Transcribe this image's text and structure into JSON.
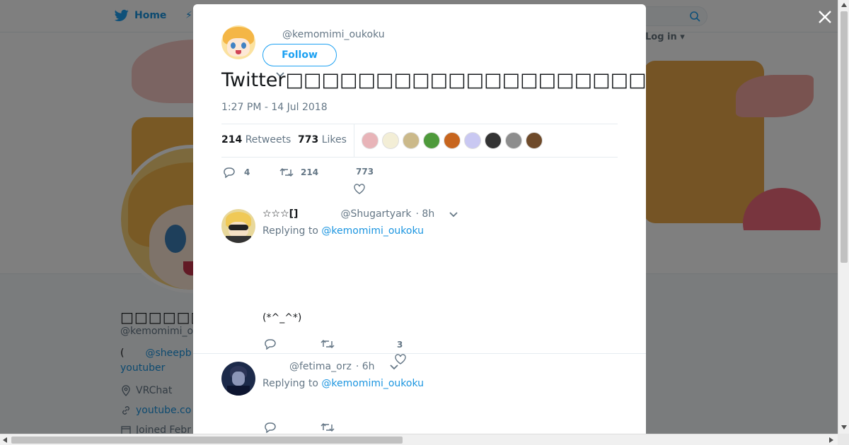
{
  "nav": {
    "home_label": "Home",
    "login_label": "Log in"
  },
  "profile": {
    "name": "□□□□□□□□□□□",
    "handle": "@kemomimi_o",
    "bio_prefix": "(",
    "bio_link": "@sheepb",
    "bio_line2": "youtuber",
    "location": "VRChat",
    "url": "youtube.co",
    "joined": "Joined Febr"
  },
  "tweet": {
    "handle": "@kemomimi_oukoku",
    "follow_label": "Follow",
    "text": "Twitter□□□□□□□□□□□□□□□□□□□□□□□□□□□□□□□□□□□□□□□□□□□□□□",
    "timestamp": "1:27 PM - 14 Jul 2018",
    "retweets_count": "214",
    "retweets_label": "Retweets",
    "likes_count": "773",
    "likes_label": "Likes",
    "reply_count": "4",
    "retweet_count": "214",
    "like_count": "773",
    "liker_colors": [
      "#e8b4b8",
      "#f3eed6",
      "#cbb98a",
      "#4e9a3b",
      "#c7651e",
      "#c9c8f2",
      "#333333",
      "#8d8d8d",
      "#6e4a2a"
    ]
  },
  "replies": [
    {
      "name": "☆☆☆[]",
      "handle": "@Shugartyark",
      "time": "· 8h",
      "replying_prefix": "Replying to",
      "replying_to": "@kemomimi_oukoku",
      "body": "(*^_^*)",
      "like_count": "3"
    },
    {
      "name": "",
      "handle": "@fetima_orz",
      "time": "· 6h",
      "replying_prefix": "Replying to",
      "replying_to": "@kemomimi_oukoku",
      "body": "",
      "like_count": ""
    }
  ]
}
